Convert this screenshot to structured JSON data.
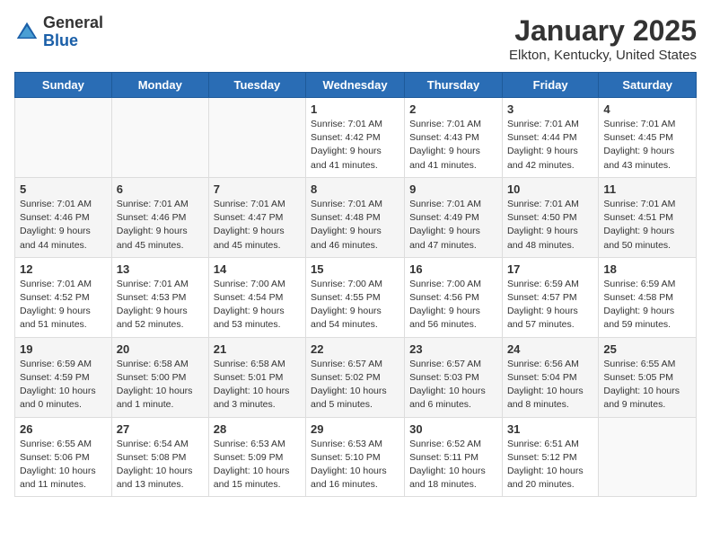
{
  "header": {
    "logo_general": "General",
    "logo_blue": "Blue",
    "month_title": "January 2025",
    "location": "Elkton, Kentucky, United States"
  },
  "weekdays": [
    "Sunday",
    "Monday",
    "Tuesday",
    "Wednesday",
    "Thursday",
    "Friday",
    "Saturday"
  ],
  "weeks": [
    [
      {
        "day": "",
        "info": ""
      },
      {
        "day": "",
        "info": ""
      },
      {
        "day": "",
        "info": ""
      },
      {
        "day": "1",
        "info": "Sunrise: 7:01 AM\nSunset: 4:42 PM\nDaylight: 9 hours\nand 41 minutes."
      },
      {
        "day": "2",
        "info": "Sunrise: 7:01 AM\nSunset: 4:43 PM\nDaylight: 9 hours\nand 41 minutes."
      },
      {
        "day": "3",
        "info": "Sunrise: 7:01 AM\nSunset: 4:44 PM\nDaylight: 9 hours\nand 42 minutes."
      },
      {
        "day": "4",
        "info": "Sunrise: 7:01 AM\nSunset: 4:45 PM\nDaylight: 9 hours\nand 43 minutes."
      }
    ],
    [
      {
        "day": "5",
        "info": "Sunrise: 7:01 AM\nSunset: 4:46 PM\nDaylight: 9 hours\nand 44 minutes."
      },
      {
        "day": "6",
        "info": "Sunrise: 7:01 AM\nSunset: 4:46 PM\nDaylight: 9 hours\nand 45 minutes."
      },
      {
        "day": "7",
        "info": "Sunrise: 7:01 AM\nSunset: 4:47 PM\nDaylight: 9 hours\nand 45 minutes."
      },
      {
        "day": "8",
        "info": "Sunrise: 7:01 AM\nSunset: 4:48 PM\nDaylight: 9 hours\nand 46 minutes."
      },
      {
        "day": "9",
        "info": "Sunrise: 7:01 AM\nSunset: 4:49 PM\nDaylight: 9 hours\nand 47 minutes."
      },
      {
        "day": "10",
        "info": "Sunrise: 7:01 AM\nSunset: 4:50 PM\nDaylight: 9 hours\nand 48 minutes."
      },
      {
        "day": "11",
        "info": "Sunrise: 7:01 AM\nSunset: 4:51 PM\nDaylight: 9 hours\nand 50 minutes."
      }
    ],
    [
      {
        "day": "12",
        "info": "Sunrise: 7:01 AM\nSunset: 4:52 PM\nDaylight: 9 hours\nand 51 minutes."
      },
      {
        "day": "13",
        "info": "Sunrise: 7:01 AM\nSunset: 4:53 PM\nDaylight: 9 hours\nand 52 minutes."
      },
      {
        "day": "14",
        "info": "Sunrise: 7:00 AM\nSunset: 4:54 PM\nDaylight: 9 hours\nand 53 minutes."
      },
      {
        "day": "15",
        "info": "Sunrise: 7:00 AM\nSunset: 4:55 PM\nDaylight: 9 hours\nand 54 minutes."
      },
      {
        "day": "16",
        "info": "Sunrise: 7:00 AM\nSunset: 4:56 PM\nDaylight: 9 hours\nand 56 minutes."
      },
      {
        "day": "17",
        "info": "Sunrise: 6:59 AM\nSunset: 4:57 PM\nDaylight: 9 hours\nand 57 minutes."
      },
      {
        "day": "18",
        "info": "Sunrise: 6:59 AM\nSunset: 4:58 PM\nDaylight: 9 hours\nand 59 minutes."
      }
    ],
    [
      {
        "day": "19",
        "info": "Sunrise: 6:59 AM\nSunset: 4:59 PM\nDaylight: 10 hours\nand 0 minutes."
      },
      {
        "day": "20",
        "info": "Sunrise: 6:58 AM\nSunset: 5:00 PM\nDaylight: 10 hours\nand 1 minute."
      },
      {
        "day": "21",
        "info": "Sunrise: 6:58 AM\nSunset: 5:01 PM\nDaylight: 10 hours\nand 3 minutes."
      },
      {
        "day": "22",
        "info": "Sunrise: 6:57 AM\nSunset: 5:02 PM\nDaylight: 10 hours\nand 5 minutes."
      },
      {
        "day": "23",
        "info": "Sunrise: 6:57 AM\nSunset: 5:03 PM\nDaylight: 10 hours\nand 6 minutes."
      },
      {
        "day": "24",
        "info": "Sunrise: 6:56 AM\nSunset: 5:04 PM\nDaylight: 10 hours\nand 8 minutes."
      },
      {
        "day": "25",
        "info": "Sunrise: 6:55 AM\nSunset: 5:05 PM\nDaylight: 10 hours\nand 9 minutes."
      }
    ],
    [
      {
        "day": "26",
        "info": "Sunrise: 6:55 AM\nSunset: 5:06 PM\nDaylight: 10 hours\nand 11 minutes."
      },
      {
        "day": "27",
        "info": "Sunrise: 6:54 AM\nSunset: 5:08 PM\nDaylight: 10 hours\nand 13 minutes."
      },
      {
        "day": "28",
        "info": "Sunrise: 6:53 AM\nSunset: 5:09 PM\nDaylight: 10 hours\nand 15 minutes."
      },
      {
        "day": "29",
        "info": "Sunrise: 6:53 AM\nSunset: 5:10 PM\nDaylight: 10 hours\nand 16 minutes."
      },
      {
        "day": "30",
        "info": "Sunrise: 6:52 AM\nSunset: 5:11 PM\nDaylight: 10 hours\nand 18 minutes."
      },
      {
        "day": "31",
        "info": "Sunrise: 6:51 AM\nSunset: 5:12 PM\nDaylight: 10 hours\nand 20 minutes."
      },
      {
        "day": "",
        "info": ""
      }
    ]
  ]
}
